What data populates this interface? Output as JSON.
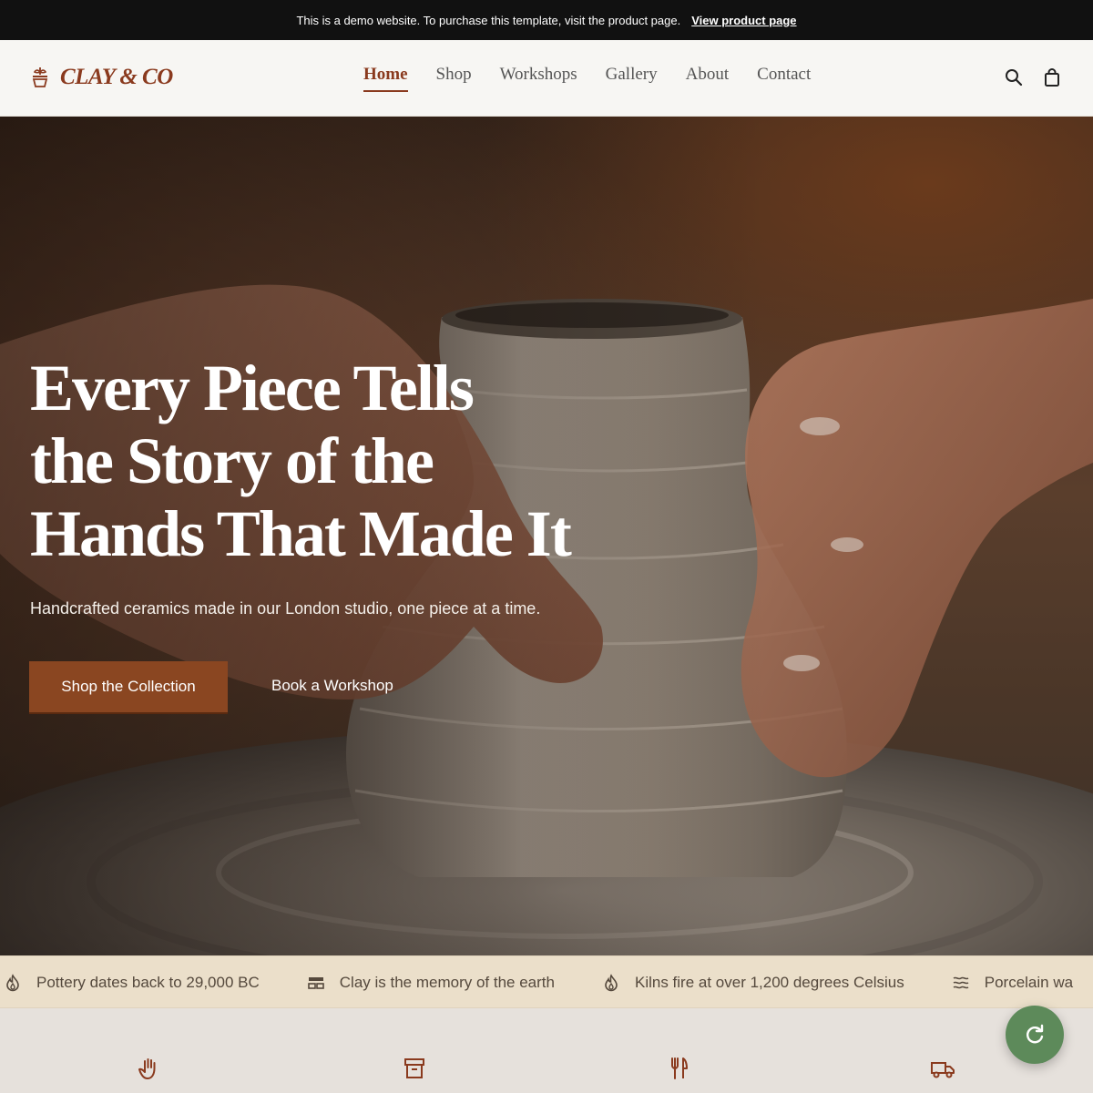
{
  "demo_banner": {
    "message": "This is a demo website. To purchase this template, visit the product page.",
    "link_label": "View product page"
  },
  "header": {
    "brand": "CLAY & CO",
    "nav": [
      {
        "label": "Home",
        "active": true
      },
      {
        "label": "Shop",
        "active": false
      },
      {
        "label": "Workshops",
        "active": false
      },
      {
        "label": "Gallery",
        "active": false
      },
      {
        "label": "About",
        "active": false
      },
      {
        "label": "Contact",
        "active": false
      }
    ],
    "icons": [
      "search-icon",
      "shopping-bag-icon"
    ]
  },
  "hero": {
    "title_lines": [
      "Every Piece Tells",
      "the Story of the",
      "Hands That Made It"
    ],
    "subtitle": "Handcrafted ceramics made in our London studio, one piece at a time.",
    "primary_cta": "Shop the Collection",
    "secondary_cta": "Book a Workshop"
  },
  "facts": [
    {
      "icon": "flame-icon",
      "text": "Pottery dates back to 29,000 BC"
    },
    {
      "icon": "layers-icon",
      "text": "Clay is the memory of the earth"
    },
    {
      "icon": "flame-icon",
      "text": "Kilns fire at over 1,200 degrees Celsius"
    },
    {
      "icon": "waves-icon",
      "text": "Porcelain wa"
    }
  ],
  "features": {
    "icons": [
      "hand-icon",
      "archive-box-icon",
      "utensils-icon",
      "truck-icon"
    ]
  },
  "colors": {
    "brand": "#8a3a1e",
    "primary_button": "#8a4621",
    "fact_strip": "#ebdfca",
    "fab": "#5d8a5a"
  },
  "fab": {
    "icon": "refresh-icon"
  }
}
